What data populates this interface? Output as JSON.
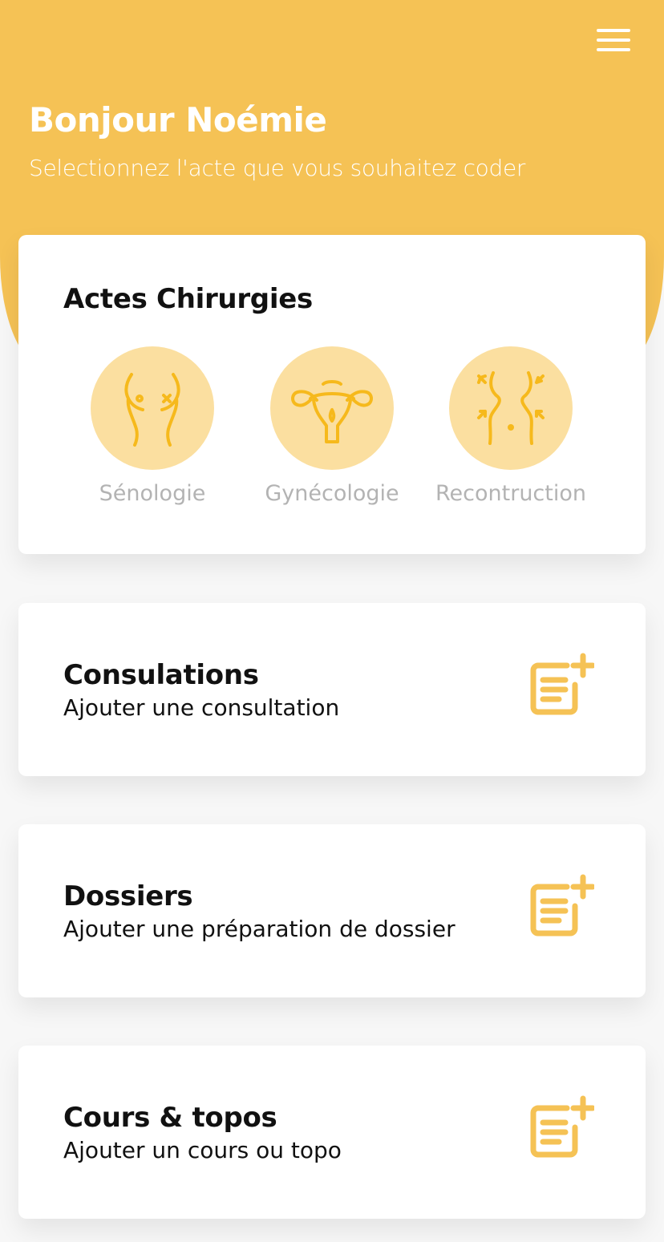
{
  "header": {
    "greeting": "Bonjour Noémie",
    "subtitle": "Selectionnez l'acte que vous souhaitez coder",
    "menu_icon": "hamburger-menu-icon"
  },
  "surgery": {
    "title": "Actes Chirurgies",
    "categories": [
      {
        "label": "Sénologie",
        "icon": "breast-icon"
      },
      {
        "label": "Gynécologie",
        "icon": "uterus-icon"
      },
      {
        "label": "Recontruction",
        "icon": "body-reconstruction-icon"
      }
    ]
  },
  "actions": [
    {
      "title": "Consulations",
      "subtitle": "Ajouter une consultation",
      "icon": "add-note-icon"
    },
    {
      "title": "Dossiers",
      "subtitle": "Ajouter une préparation de dossier",
      "icon": "add-note-icon"
    },
    {
      "title": "Cours & topos",
      "subtitle": "Ajouter un cours ou topo",
      "icon": "add-note-icon"
    }
  ],
  "colors": {
    "accent": "#f5c255",
    "icon_circle": "#fbdfa0",
    "icon_stroke": "#f6b91c",
    "label_gray": "#b3b3b3"
  }
}
